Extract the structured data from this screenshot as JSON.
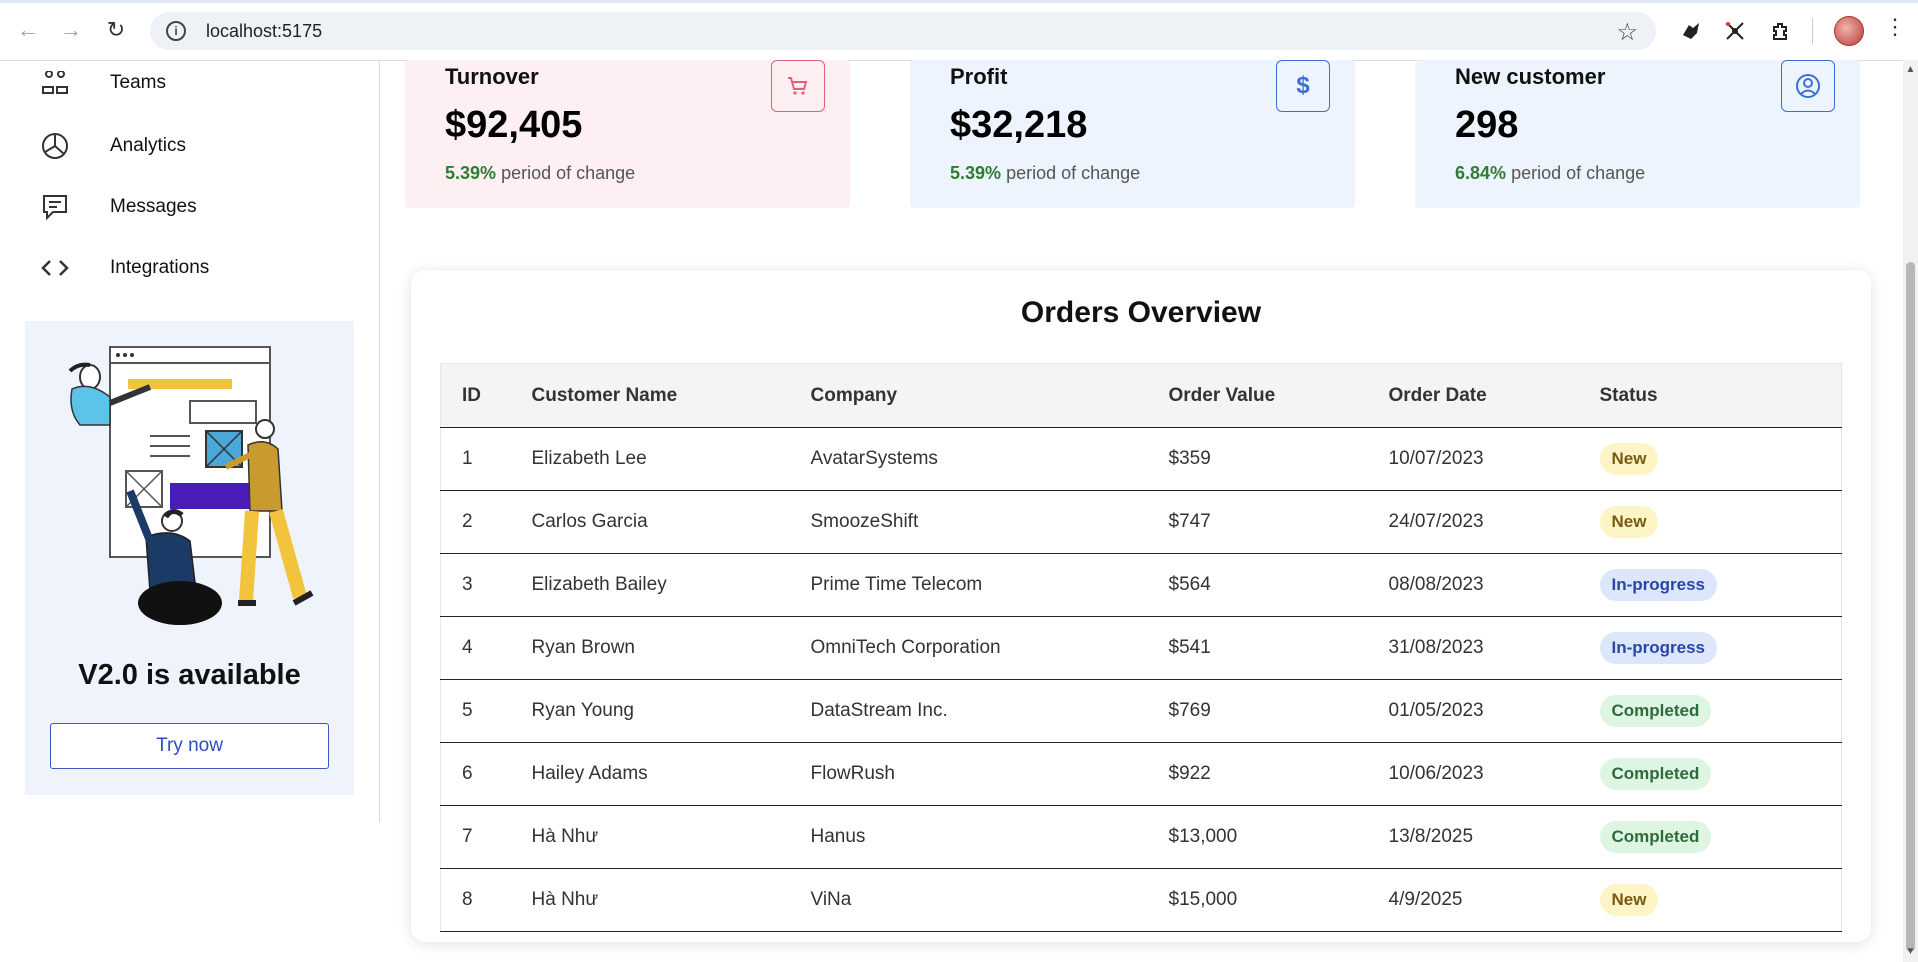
{
  "browser": {
    "url": "localhost:5175"
  },
  "sidebar": {
    "items": [
      {
        "label": "Teams",
        "icon": "teams-icon"
      },
      {
        "label": "Analytics",
        "icon": "pie-chart-icon"
      },
      {
        "label": "Messages",
        "icon": "message-icon"
      },
      {
        "label": "Integrations",
        "icon": "code-icon"
      }
    ],
    "promo": {
      "title": "V2.0 is available",
      "button": "Try now"
    }
  },
  "stats": [
    {
      "title": "Turnover",
      "value": "$92,405",
      "change": "5.39%",
      "change_text": "period of change",
      "icon": "cart-icon",
      "accent": "#e0607e",
      "bg": "#fdeff2"
    },
    {
      "title": "Profit",
      "value": "$32,218",
      "change": "5.39%",
      "change_text": "period of change",
      "icon": "dollar-icon",
      "accent": "#3b6fd8",
      "bg": "#eef4fd"
    },
    {
      "title": "New customer",
      "value": "298",
      "change": "6.84%",
      "change_text": "period of change",
      "icon": "user-circle-icon",
      "accent": "#3b6fd8",
      "bg": "#eef4fd"
    }
  ],
  "orders": {
    "title": "Orders Overview",
    "columns": [
      "ID",
      "Customer Name",
      "Company",
      "Order Value",
      "Order Date",
      "Status"
    ],
    "rows": [
      {
        "id": "1",
        "customer": "Elizabeth Lee",
        "company": "AvatarSystems",
        "value": "$359",
        "date": "10/07/2023",
        "status": "New"
      },
      {
        "id": "2",
        "customer": "Carlos Garcia",
        "company": "SmoozeShift",
        "value": "$747",
        "date": "24/07/2023",
        "status": "New"
      },
      {
        "id": "3",
        "customer": "Elizabeth Bailey",
        "company": "Prime Time Telecom",
        "value": "$564",
        "date": "08/08/2023",
        "status": "In-progress"
      },
      {
        "id": "4",
        "customer": "Ryan Brown",
        "company": "OmniTech Corporation",
        "value": "$541",
        "date": "31/08/2023",
        "status": "In-progress"
      },
      {
        "id": "5",
        "customer": "Ryan Young",
        "company": "DataStream Inc.",
        "value": "$769",
        "date": "01/05/2023",
        "status": "Completed"
      },
      {
        "id": "6",
        "customer": "Hailey Adams",
        "company": "FlowRush",
        "value": "$922",
        "date": "10/06/2023",
        "status": "Completed"
      },
      {
        "id": "7",
        "customer": "Hà Như",
        "company": "Hanus",
        "value": "$13,000",
        "date": "13/8/2025",
        "status": "Completed"
      },
      {
        "id": "8",
        "customer": "Hà Như",
        "company": "ViNa",
        "value": "$15,000",
        "date": "4/9/2025",
        "status": "New"
      }
    ]
  }
}
